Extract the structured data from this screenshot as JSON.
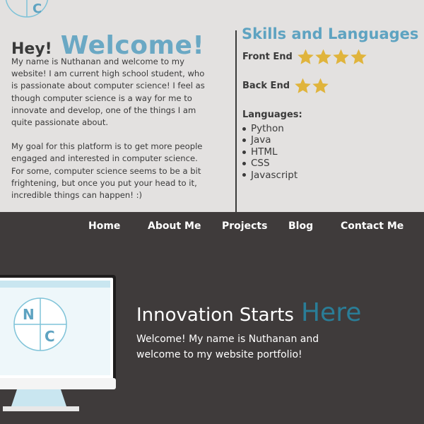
{
  "intro": {
    "greeting": "Hey!",
    "welcome": "Welcome!",
    "paragraph1": "My name is Nuthanan and welcome to my website! I am current high school student, who is passionate about computer science! I feel as though computer science is a way for me to innovate and develop, one of the things I am quite passionate about.",
    "paragraph2": "My goal for this platform is to get more people engaged and interested in computer science. For some, computer science seems to be a bit frightening, but once you put your head to it, incredible things can happen! :)"
  },
  "skills": {
    "title": "Skills and Languages",
    "front_end": {
      "label": "Front End",
      "stars": 4
    },
    "back_end": {
      "label": "Back End",
      "stars": 2
    },
    "languages_title": "Languages:",
    "languages": [
      "Python",
      "Java",
      "HTML",
      "CSS",
      "Javascript"
    ]
  },
  "nav": {
    "home": "Home",
    "about": "About Me",
    "projects": "Projects",
    "blog": "Blog",
    "contact": "Contact Me"
  },
  "hero": {
    "title_part1": "Innovation Starts",
    "title_part2": "Here",
    "subtitle": "Welcome! My name is Nuthanan and welcome to my website portfolio!"
  },
  "logo": {
    "letter_top": "N",
    "letter_bottom": "C"
  },
  "colors": {
    "accent_blue": "#6aa8c4",
    "hero_blue": "#2a7d97",
    "star_gold": "#e0b43c",
    "dark_bg": "#3f3b3b",
    "light_bg": "#e3e1e0"
  },
  "icons": {
    "logo": "nc-circle-logo",
    "star": "star-icon",
    "monitor": "monitor-icon"
  }
}
